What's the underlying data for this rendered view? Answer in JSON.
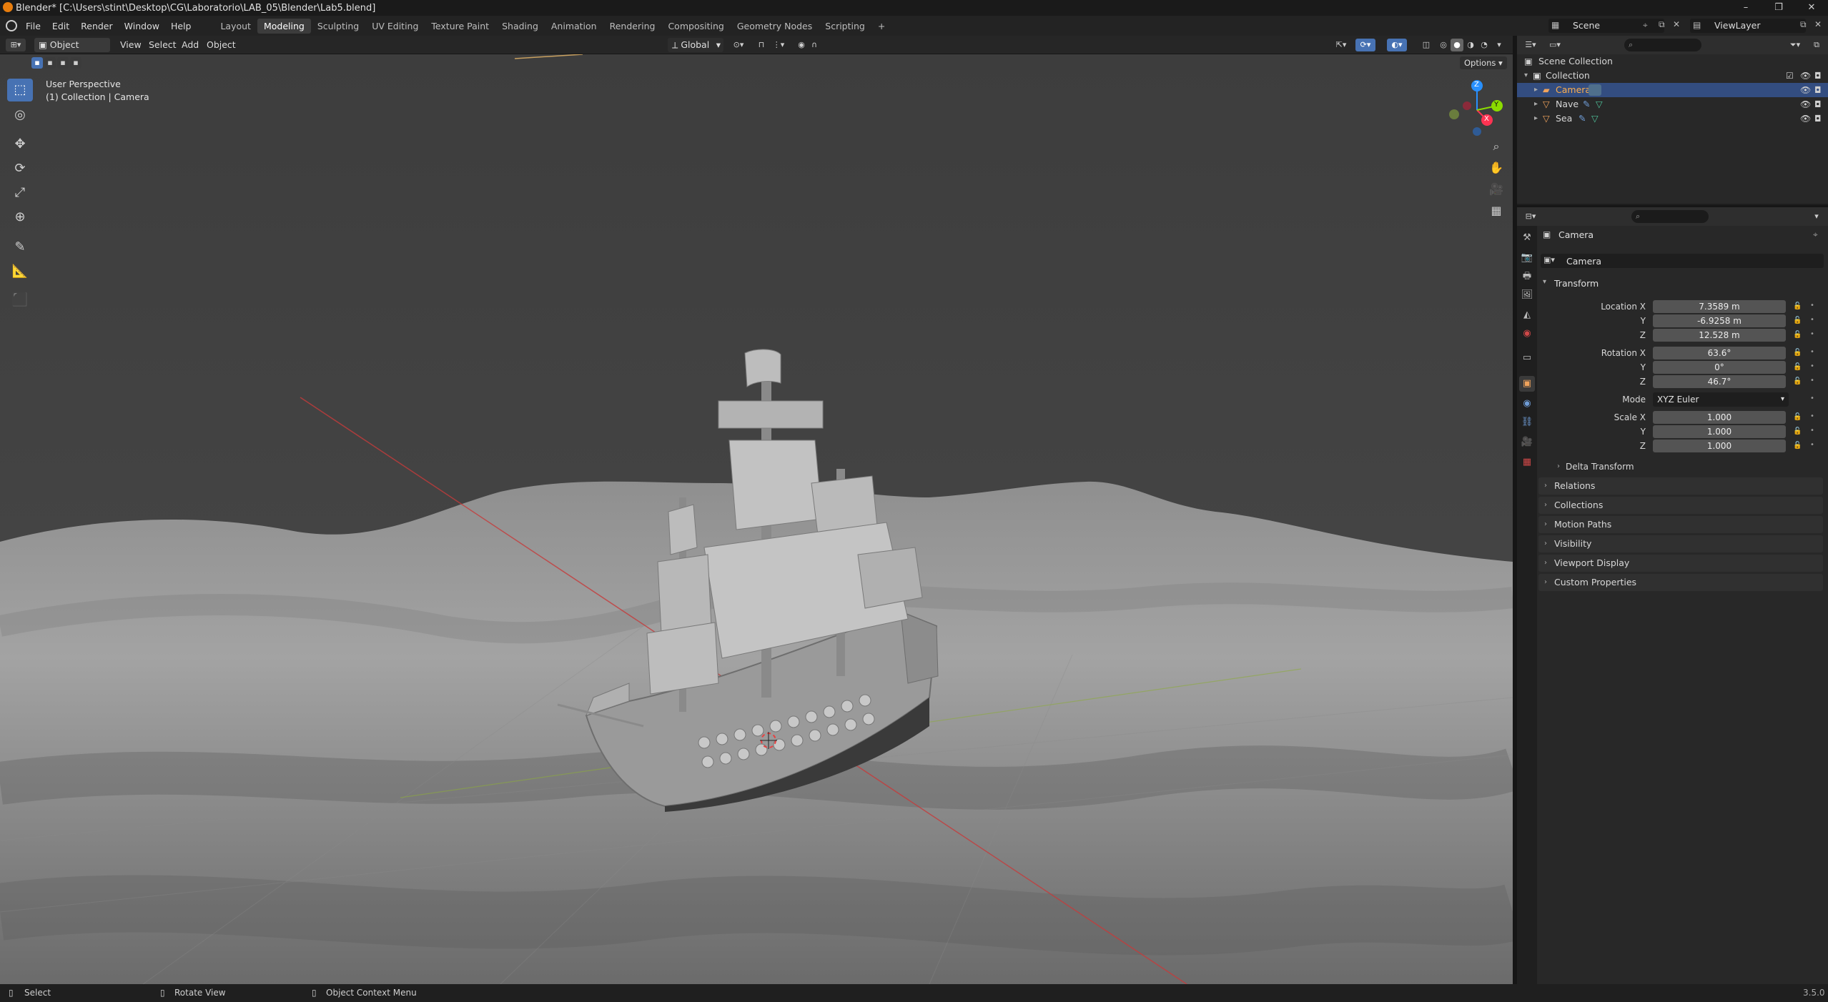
{
  "window": {
    "title": "Blender* [C:\\Users\\stint\\Desktop\\CG\\Laboratorio\\LAB_05\\Blender\\Lab5.blend]"
  },
  "menubar": {
    "menus": [
      "File",
      "Edit",
      "Render",
      "Window",
      "Help"
    ],
    "workspaces": [
      "Layout",
      "Modeling",
      "Sculpting",
      "UV Editing",
      "Texture Paint",
      "Shading",
      "Animation",
      "Rendering",
      "Compositing",
      "Geometry Nodes",
      "Scripting"
    ],
    "active_workspace": "Modeling",
    "add_workspace": "+",
    "scene_name": "Scene",
    "view_layer": "ViewLayer"
  },
  "viewport_header": {
    "mode": "Object Mode",
    "menus": [
      "View",
      "Select",
      "Add",
      "Object"
    ],
    "orientation": "Global",
    "options_label": "Options"
  },
  "viewport": {
    "perspective": "User Perspective",
    "context": "(1) Collection | Camera",
    "gizmo_axes": [
      "X",
      "Y",
      "Z"
    ]
  },
  "outliner": {
    "rows": [
      {
        "label": "Scene Collection",
        "indent": 0
      },
      {
        "label": "Collection",
        "indent": 1
      },
      {
        "label": "Camera",
        "indent": 2,
        "selected": true
      },
      {
        "label": "Nave",
        "indent": 2
      },
      {
        "label": "Sea",
        "indent": 2
      }
    ]
  },
  "properties": {
    "object_name": "Camera",
    "data_name": "Camera",
    "transform_label": "Transform",
    "location": {
      "label": "Location X",
      "x": "7.3589 m",
      "y": "-6.9258 m",
      "z": "12.528 m"
    },
    "rotation": {
      "label": "Rotation X",
      "x": "63.6°",
      "y": "0°",
      "z": "46.7°"
    },
    "mode": {
      "label": "Mode",
      "value": "XYZ Euler"
    },
    "scale": {
      "label": "Scale X",
      "x": "1.000",
      "y": "1.000",
      "z": "1.000"
    },
    "axis_y": "Y",
    "axis_z": "Z",
    "delta_transform": "Delta Transform",
    "panels": [
      "Relations",
      "Collections",
      "Motion Paths",
      "Visibility",
      "Viewport Display",
      "Custom Properties"
    ]
  },
  "statusbar": {
    "select": "Select",
    "rotate": "Rotate View",
    "context_menu": "Object Context Menu",
    "version": "3.5.0"
  },
  "colors": {
    "accent": "#4772b3",
    "selection": "#334d80",
    "object_orange": "#f0a35c",
    "x_axis": "#ff3352",
    "y_axis": "#8bdc00",
    "z_axis": "#2890ff"
  }
}
